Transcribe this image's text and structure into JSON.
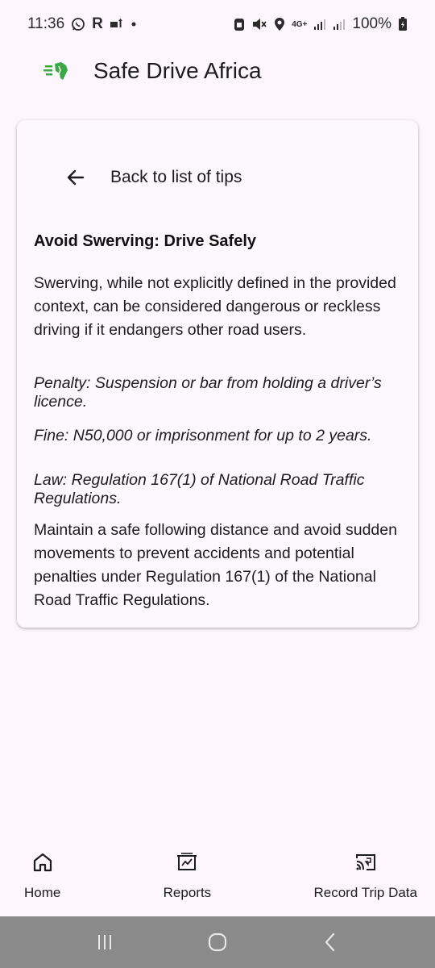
{
  "status_bar": {
    "time": "11:36",
    "carrier_letter": "R",
    "network": "4G+",
    "battery": "100%"
  },
  "app": {
    "title": "Safe Drive Africa",
    "logo_icon": "safe-drive-africa-logo"
  },
  "tip_detail": {
    "back_label": "Back to list of tips",
    "title": "Avoid Swerving: Drive Safely",
    "body": "Swerving, while not explicitly defined in the provided context, can be considered dangerous or reckless driving if it endangers other road users.",
    "penalty": "Penalty: Suspension or bar from holding a driver’s licence.",
    "fine": "Fine: N50,000 or imprisonment for up to 2 years.",
    "law": "Law: Regulation 167(1) of National Road Traffic Regulations.",
    "advice": "Maintain a safe following distance and avoid sudden movements to prevent accidents and potential penalties under Regulation 167(1) of the National Road Traffic Regulations."
  },
  "bottom_nav": {
    "items": [
      {
        "label": "Home",
        "icon": "home-icon"
      },
      {
        "label": "Reports",
        "icon": "reports-icon"
      },
      {
        "label": "Record Trip Data",
        "icon": "cast-record-icon"
      }
    ]
  },
  "system_nav": {
    "buttons": [
      "recent-apps",
      "home",
      "back"
    ]
  },
  "colors": {
    "background": "#fdf7fd",
    "system_nav": "#8a8a8a",
    "logo_green": "#3aa845"
  }
}
